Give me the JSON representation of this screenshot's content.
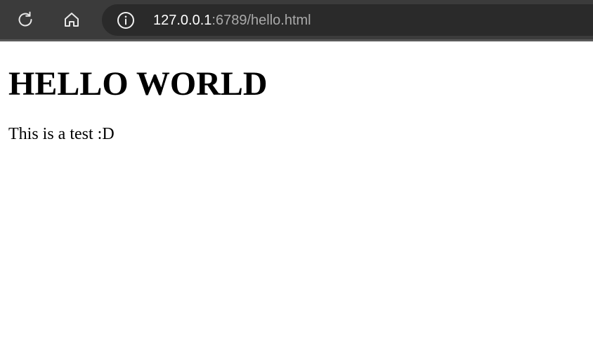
{
  "browser": {
    "toolbar": {
      "refresh_icon": "refresh-icon",
      "home_icon": "home-icon",
      "site_info_icon": "info-circle-icon"
    },
    "address_bar": {
      "host": "127.0.0.1",
      "rest": ":6789/hello.html"
    },
    "colors": {
      "toolbar_bg": "#3b3b3b",
      "address_bar_bg": "#2a2a2a",
      "url_host": "#ffffff",
      "url_rest": "#a9a9a9",
      "page_bg": "#ffffff",
      "page_text": "#000000"
    }
  },
  "page": {
    "heading": "HELLO WORLD",
    "paragraph": "This is a test :D"
  }
}
